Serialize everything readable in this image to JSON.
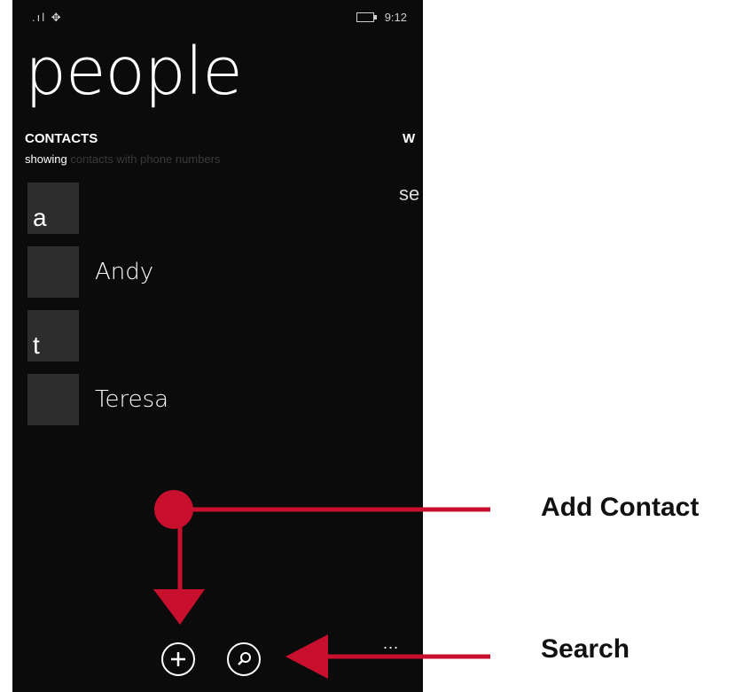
{
  "status_bar": {
    "signal": ".ıl ✥",
    "time": "9:12"
  },
  "app": {
    "title": "people"
  },
  "contacts_section": {
    "header": "CONTACTS",
    "subtitle_prefix": "showing",
    "subtitle_rest": "contacts with phone numbers"
  },
  "next_pivot": {
    "header": "W",
    "body": "se"
  },
  "contact_groups": [
    {
      "letter": "a",
      "contacts": [
        "Andy"
      ]
    },
    {
      "letter": "t",
      "contacts": [
        "Teresa"
      ]
    }
  ],
  "app_bar": {
    "add_icon": "plus-circle-icon",
    "search_icon": "magnifier-circle-icon",
    "more": "..."
  },
  "annotations": {
    "add_contact": "Add Contact",
    "search": "Search",
    "color": "#c8102e"
  }
}
